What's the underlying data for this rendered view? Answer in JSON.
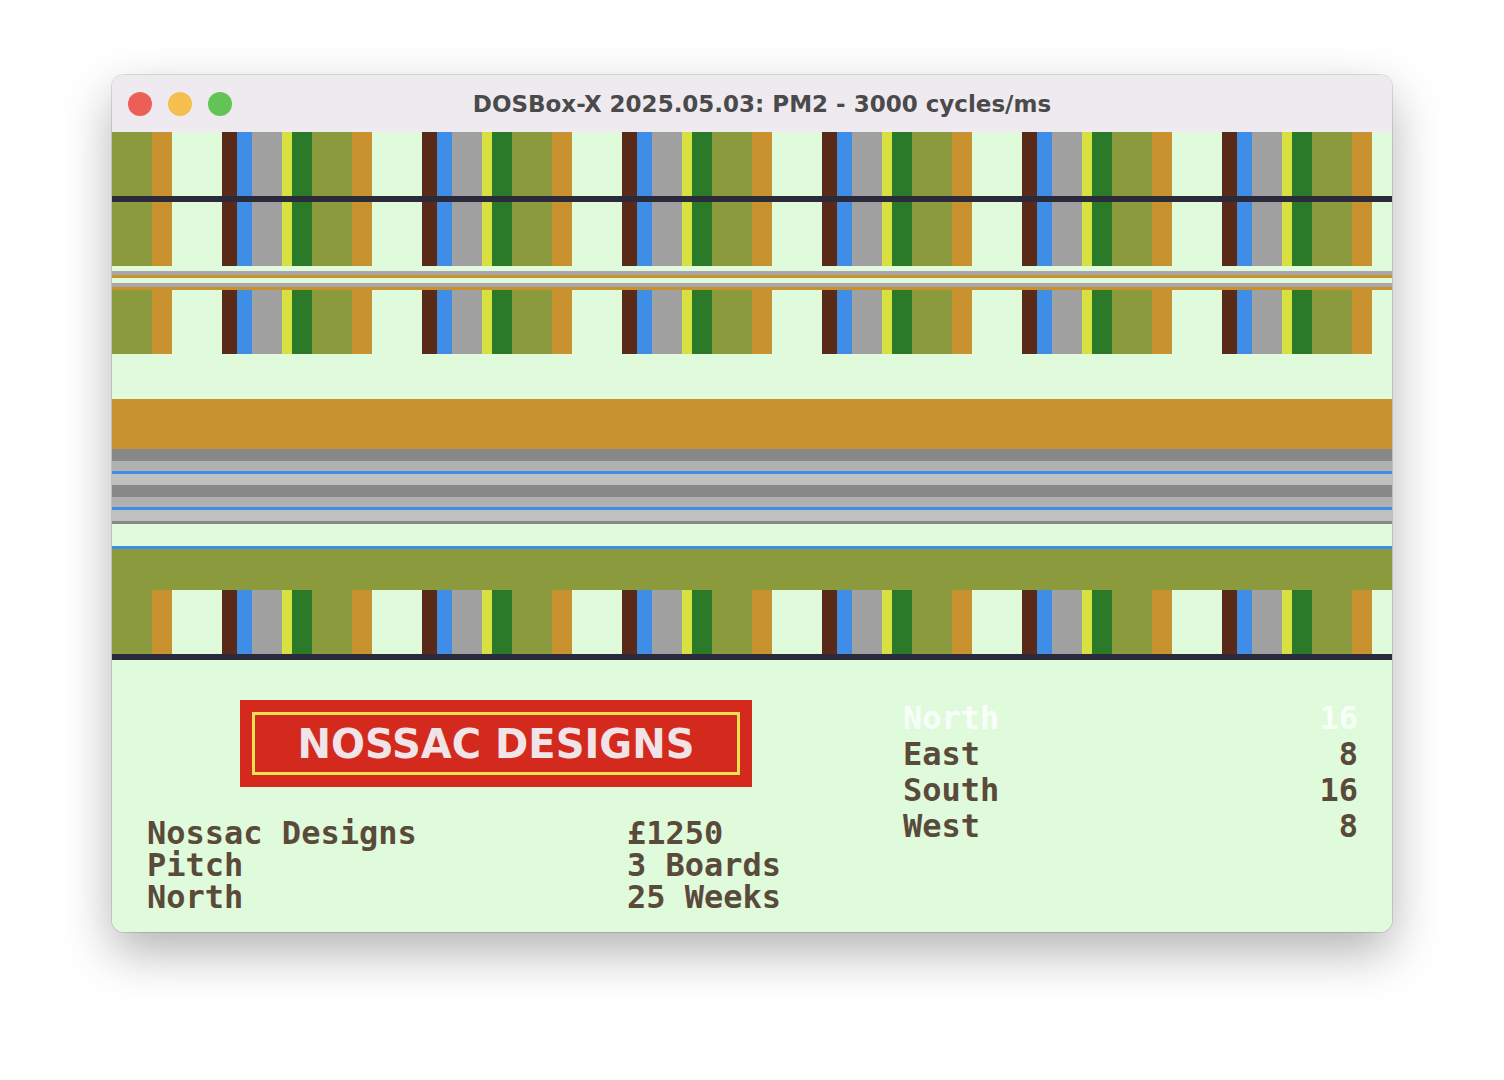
{
  "window": {
    "title": "DOSBox-X 2025.05.03: PM2 - 3000 cycles/ms"
  },
  "logo": {
    "text": "NOSSAC DESIGNS"
  },
  "info": [
    {
      "label": "Nossac Designs",
      "value": "£1250"
    },
    {
      "label": "Pitch",
      "value": "3 Boards"
    },
    {
      "label": "North",
      "value": "25 Weeks"
    }
  ],
  "directions": [
    {
      "name": "North",
      "value": "16",
      "selected": true
    },
    {
      "name": "East",
      "value": "8",
      "selected": false
    },
    {
      "name": "South",
      "value": "16",
      "selected": false
    },
    {
      "name": "West",
      "value": "8",
      "selected": false
    }
  ]
}
